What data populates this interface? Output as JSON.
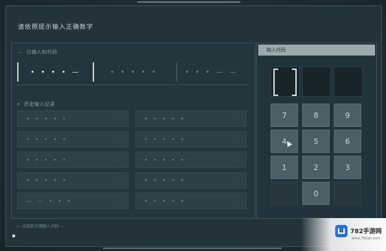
{
  "screen": {
    "prompt": "请依照提示输入正确数字"
  },
  "code_section": {
    "heading": "已输入的代码",
    "slots": [
      {
        "text": "• • • • —",
        "state": "active"
      },
      {
        "text": "• • • • •",
        "state": "dim"
      },
      {
        "text": "• • • — —",
        "state": "dim"
      }
    ]
  },
  "log_section": {
    "heading": "历史输入记录",
    "rows": [
      [
        "• • •   •   •",
        "• • • • •"
      ],
      [
        "• • •   •   •",
        "• • • • •"
      ],
      [
        "• •   •   •   •",
        "• • • • •"
      ],
      [
        "• • •   • •",
        "• • • • •"
      ],
      [
        "— — • •   •",
        "• • • • •"
      ]
    ]
  },
  "footer": {
    "label": "— 点击数字键输入代码 —"
  },
  "keypad": {
    "entry_label": "输入代码",
    "keys": [
      [
        "7",
        "8",
        "9"
      ],
      [
        "4",
        "5",
        "6"
      ],
      [
        "1",
        "2",
        "3"
      ],
      [
        "",
        "0",
        ""
      ]
    ]
  },
  "watermark": {
    "name": "782手游网",
    "url": "www.782ak.com"
  },
  "colors": {
    "panel": "#24363d",
    "key": "#4c5f66",
    "highlight": "#d6e1e4"
  }
}
